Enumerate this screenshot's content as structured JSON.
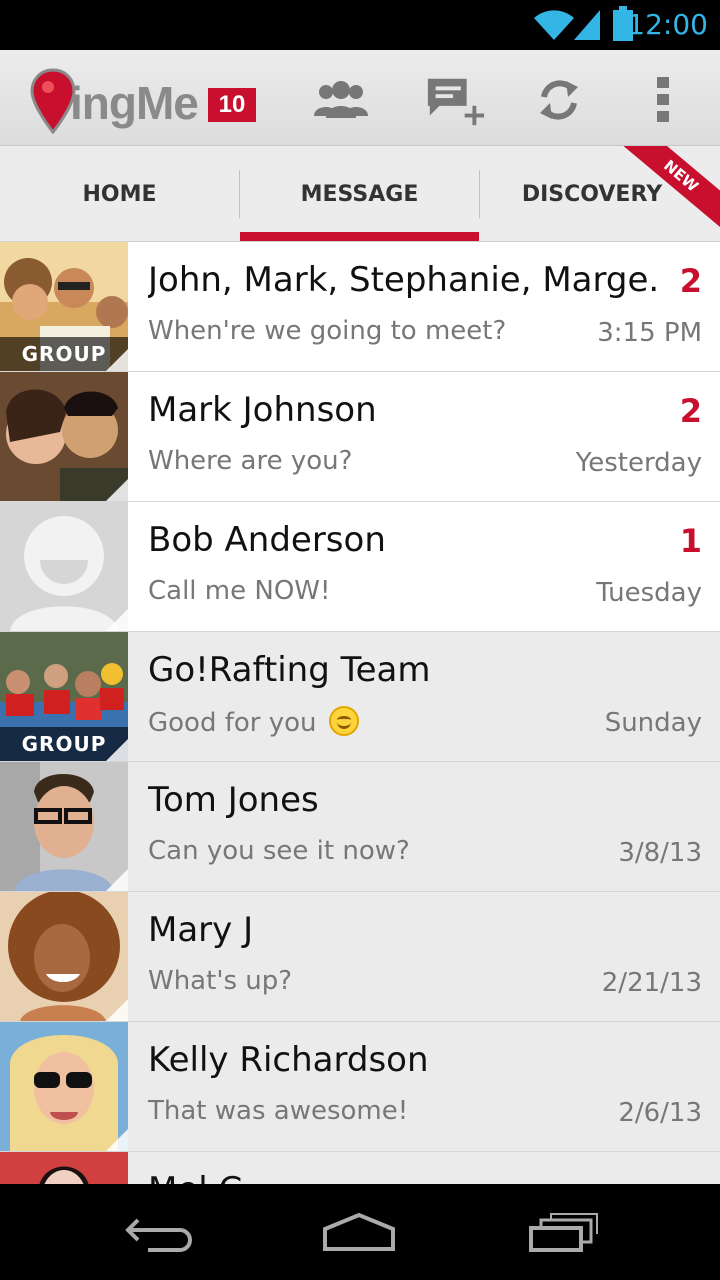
{
  "status_bar": {
    "time": "12:00",
    "accent": "#33b5e5"
  },
  "app": {
    "name_word": "ingMe",
    "badge": "10",
    "brand_color": "#c8102e"
  },
  "action_bar": {
    "icons": [
      "contacts-icon",
      "new-message-icon",
      "refresh-icon",
      "overflow-menu-icon"
    ]
  },
  "tabs": [
    {
      "label": "HOME",
      "active": false
    },
    {
      "label": "MESSAGE",
      "active": true
    },
    {
      "label": "DISCOVERY",
      "active": false,
      "ribbon": "NEW"
    }
  ],
  "conversations": [
    {
      "name": "John, Mark, Stephanie, Marge...",
      "preview": "When're we going to meet?",
      "time": "3:15 PM",
      "count": "2",
      "group": true,
      "group_label": "GROUP",
      "unread": true
    },
    {
      "name": "Mark Johnson",
      "preview": "Where are you?",
      "time": "Yesterday",
      "count": "2",
      "group": false,
      "unread": true
    },
    {
      "name": "Bob Anderson",
      "preview": "Call me NOW!",
      "time": "Tuesday",
      "count": "1",
      "group": false,
      "unread": true
    },
    {
      "name": "Go!Rafting Team",
      "preview": "Good for you",
      "time": "Sunday",
      "count": "",
      "group": true,
      "group_label": "GROUP",
      "unread": false,
      "emoji": "smiley-emoji-icon"
    },
    {
      "name": "Tom Jones",
      "preview": "Can you see it now?",
      "time": "3/8/13",
      "count": "",
      "group": false,
      "unread": false
    },
    {
      "name": "Mary J",
      "preview": "What's up?",
      "time": "2/21/13",
      "count": "",
      "group": false,
      "unread": false
    },
    {
      "name": "Kelly Richardson",
      "preview": "That was awesome!",
      "time": "2/6/13",
      "count": "",
      "group": false,
      "unread": false
    },
    {
      "name": "Mel C",
      "preview": "",
      "time": "",
      "count": "",
      "group": false,
      "unread": false
    }
  ],
  "nav_bar": {
    "icons": [
      "back-icon",
      "home-icon",
      "recent-apps-icon"
    ]
  }
}
